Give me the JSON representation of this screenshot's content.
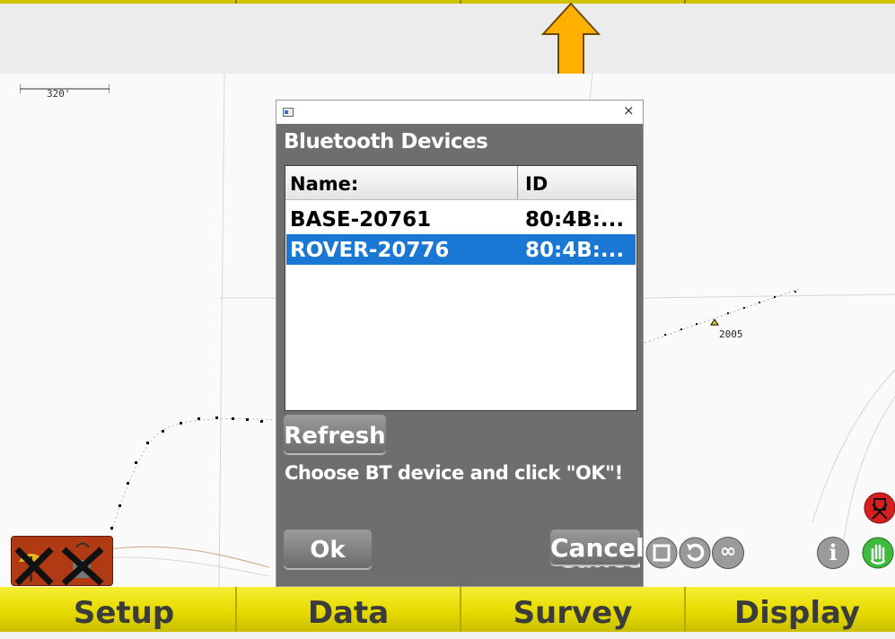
{
  "map": {
    "scale_label": "320'",
    "point_label": "2005"
  },
  "dialog": {
    "title": "Bluetooth Devices",
    "close_glyph": "×",
    "columns": [
      "Name:",
      "ID"
    ],
    "devices": [
      {
        "name": "BASE-20761",
        "id": "80:4B:...",
        "selected": false
      },
      {
        "name": "ROVER-20776",
        "id": "80:4B:...",
        "selected": true
      }
    ],
    "refresh_label": "Refresh",
    "message": "Choose BT device and click \"OK\"!",
    "ok_label": "Ok",
    "cancel_label": "Cancel"
  },
  "toolbar": {
    "info_glyph": "i",
    "loop_glyph": "∞"
  },
  "bottom_tabs": [
    "Setup",
    "Data",
    "Survey",
    "Display"
  ],
  "colors": {
    "tab_bar": "#e6db00",
    "arrow": "#ffb000",
    "selection": "#1a78d4",
    "dialog_bg": "#6e6e6e"
  }
}
